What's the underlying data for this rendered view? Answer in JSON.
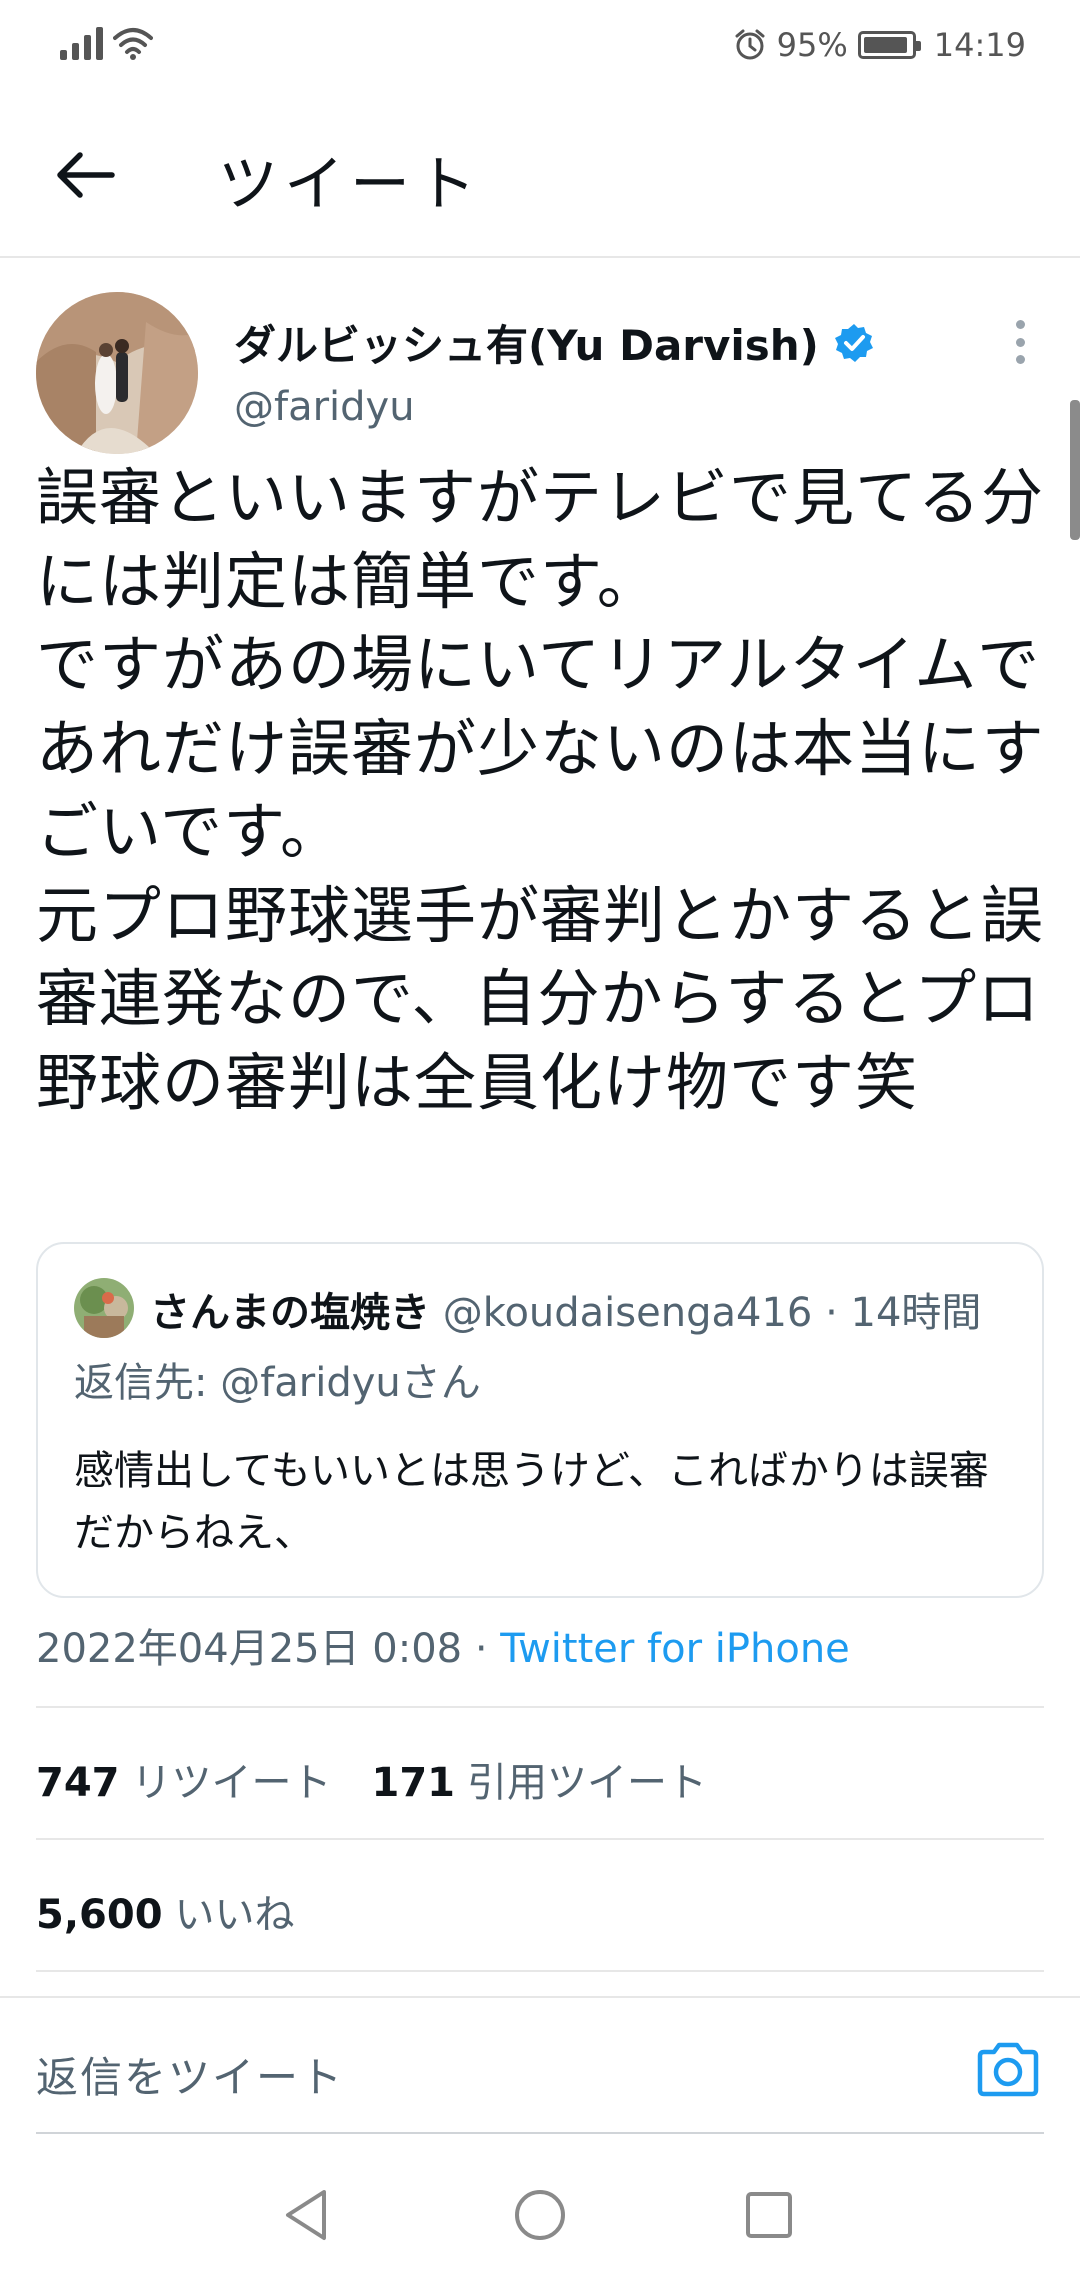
{
  "status_bar": {
    "battery": "95%",
    "time": "14:19",
    "battery_level": 0.95
  },
  "header": {
    "title": "ツイート"
  },
  "tweet": {
    "author_name": "ダルビッシュ有(Yu Darvish)",
    "author_handle": "@faridyu",
    "text": "誤審といいますがテレビで見てる分には判定は簡単です。\nですがあの場にいてリアルタイムであれだけ誤審が少ないのは本当にすごいです。\n元プロ野球選手が審判とかすると誤審連発なので、自分からするとプロ野球の審判は全員化け物です笑",
    "quote": {
      "name": "さんまの塩焼き",
      "handle": "@koudaisenga416",
      "time": "· 14時間",
      "reply_to": "返信先: @faridyuさん",
      "text": "感情出してもいいとは思うけど、こればかりは誤審だからねえ、"
    },
    "timestamp": "2022年04月25日 0:08 · ",
    "source": "Twitter for iPhone",
    "retweets_count": "747",
    "retweets_label": "リツイート",
    "quotes_count": "171",
    "quotes_label": "引用ツイート",
    "likes_count": "5,600",
    "likes_label": "いいね"
  },
  "reply_bar": {
    "placeholder": "返信をツイート"
  },
  "icons": {
    "back": "arrow-left-icon",
    "verified": "verified-badge-icon",
    "more": "more-vertical-icon",
    "camera": "camera-icon",
    "nav_back": "triangle-back-icon",
    "nav_home": "circle-home-icon",
    "nav_recent": "square-recent-icon"
  },
  "colors": {
    "accent": "#1d9bf0",
    "text": "#0f1419",
    "secondary": "#536471"
  }
}
